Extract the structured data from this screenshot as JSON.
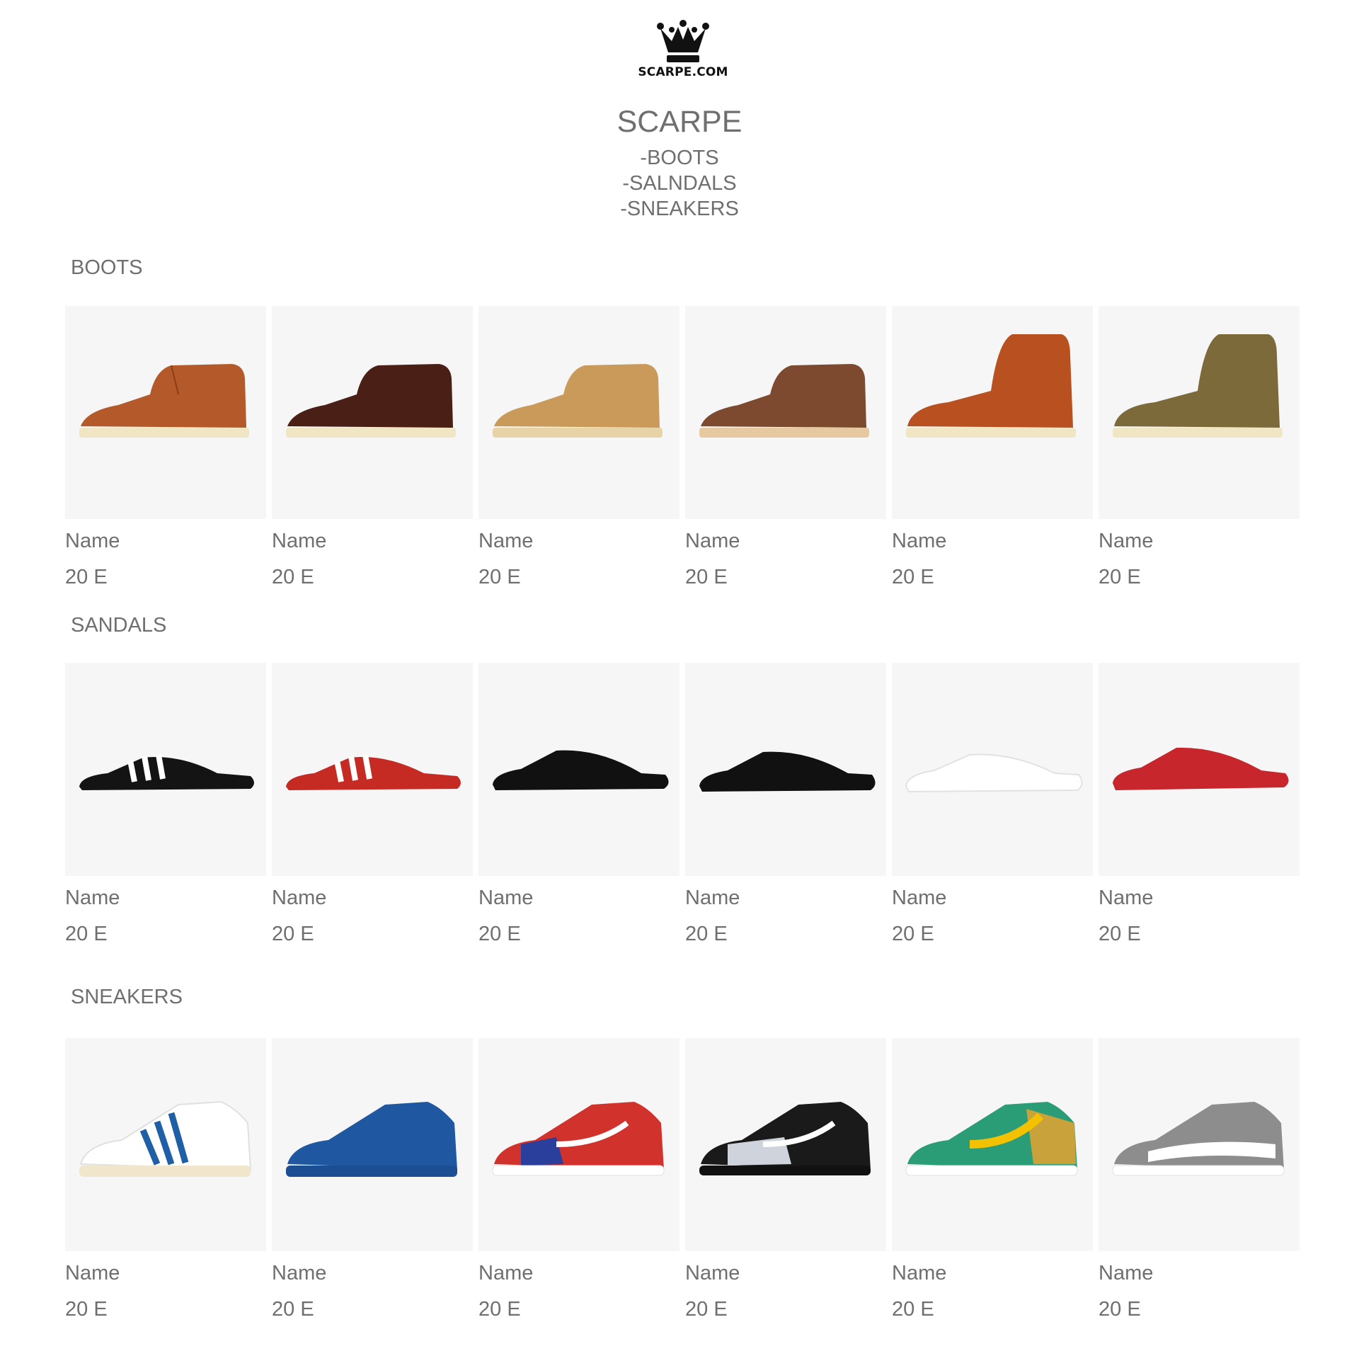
{
  "brand": {
    "logo_icon": "crown-icon",
    "logo_text": "SCARPE.COM",
    "title": "SCARPE"
  },
  "nav": [
    "-BOOTS",
    "-SALNDALS",
    "-SNEAKERS"
  ],
  "colors": {
    "tile_bg": "#f6f6f6",
    "text": "#6f6f6f"
  },
  "sections": [
    {
      "title": "BOOTS",
      "products": [
        {
          "name": "Name",
          "price": "20 E",
          "image": "brown-leather-chukka-boot"
        },
        {
          "name": "Name",
          "price": "20 E",
          "image": "dark-brown-chukka-boot"
        },
        {
          "name": "Name",
          "price": "20 E",
          "image": "tan-suede-chukka-boot"
        },
        {
          "name": "Name",
          "price": "20 E",
          "image": "brown-chukka-boot"
        },
        {
          "name": "Name",
          "price": "20 E",
          "image": "orange-moc-toe-work-boot"
        },
        {
          "name": "Name",
          "price": "20 E",
          "image": "olive-suede-moc-toe-boot"
        }
      ]
    },
    {
      "title": "SANDALS",
      "products": [
        {
          "name": "Name",
          "price": "20 E",
          "image": "black-three-stripe-slide"
        },
        {
          "name": "Name",
          "price": "20 E",
          "image": "red-three-stripe-slide"
        },
        {
          "name": "Name",
          "price": "20 E",
          "image": "black-slide"
        },
        {
          "name": "Name",
          "price": "20 E",
          "image": "black-swoosh-slide"
        },
        {
          "name": "Name",
          "price": "20 E",
          "image": "white-slide"
        },
        {
          "name": "Name",
          "price": "20 E",
          "image": "red-slide"
        }
      ]
    },
    {
      "title": "SNEAKERS",
      "products": [
        {
          "name": "Name",
          "price": "20 E",
          "image": "white-blue-stripe-sneaker"
        },
        {
          "name": "Name",
          "price": "20 E",
          "image": "blue-suede-sneaker"
        },
        {
          "name": "Name",
          "price": "20 E",
          "image": "red-blue-low-sneaker"
        },
        {
          "name": "Name",
          "price": "20 E",
          "image": "black-grey-low-sneaker"
        },
        {
          "name": "Name",
          "price": "20 E",
          "image": "green-yellow-running-sneaker"
        },
        {
          "name": "Name",
          "price": "20 E",
          "image": "grey-knit-running-sneaker"
        }
      ]
    }
  ]
}
